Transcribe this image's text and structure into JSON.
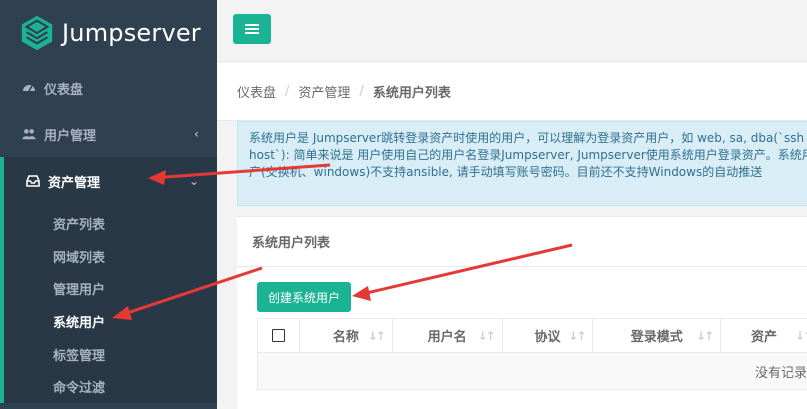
{
  "app": {
    "name": "Jumpserver"
  },
  "sidebar": {
    "items": [
      {
        "label": "仪表盘",
        "icon": "dashboard-icon"
      },
      {
        "label": "用户管理",
        "icon": "users-icon",
        "chevron": "‹"
      },
      {
        "label": "资产管理",
        "icon": "inbox-icon",
        "chevron": "⌄",
        "active": true
      }
    ],
    "submenu": [
      {
        "label": "资产列表"
      },
      {
        "label": "网域列表"
      },
      {
        "label": "管理用户"
      },
      {
        "label": "系统用户",
        "active": true
      },
      {
        "label": "标签管理"
      },
      {
        "label": "命令过滤"
      }
    ]
  },
  "breadcrumb": [
    "仪表盘",
    "资产管理",
    "系统用户列表"
  ],
  "alert": {
    "line1": "系统用户是 Jumpserver跳转登录资产时使用的用户，可以理解为登录资产用户，如 web, sa, dba(`ssh we",
    "line2": "host`): 简单来说是 用户使用自己的用户名登录Jumpserver, Jumpserver使用系统用户登录资产。系统用户",
    "line3": "产(交换机、windows)不支持ansible, 请手动填写账号密码。目前还不支持Windows的自动推送"
  },
  "panel": {
    "title": "系统用户列表",
    "create_button": "创建系统用户",
    "columns": [
      "名称",
      "用户名",
      "协议",
      "登录模式",
      "资产"
    ],
    "empty_text": "没有记录"
  },
  "colors": {
    "sidebar_bg": "#2f4050",
    "accent": "#1ab394",
    "alert_bg": "#d9edf7",
    "arrow": "#e53935"
  }
}
